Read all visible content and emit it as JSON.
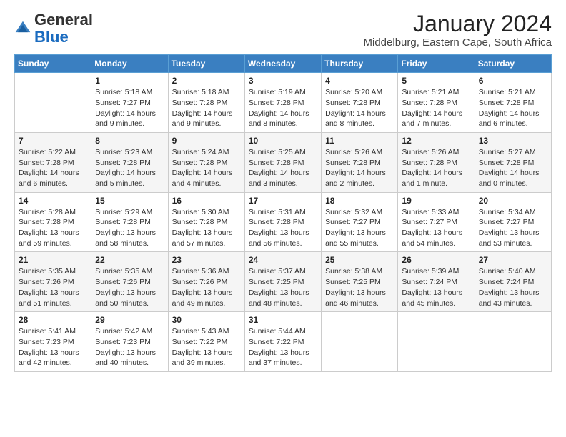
{
  "logo": {
    "general": "General",
    "blue": "Blue"
  },
  "header": {
    "month": "January 2024",
    "location": "Middelburg, Eastern Cape, South Africa"
  },
  "weekdays": [
    "Sunday",
    "Monday",
    "Tuesday",
    "Wednesday",
    "Thursday",
    "Friday",
    "Saturday"
  ],
  "weeks": [
    [
      {
        "day": "",
        "info": ""
      },
      {
        "day": "1",
        "info": "Sunrise: 5:18 AM\nSunset: 7:27 PM\nDaylight: 14 hours\nand 9 minutes."
      },
      {
        "day": "2",
        "info": "Sunrise: 5:18 AM\nSunset: 7:28 PM\nDaylight: 14 hours\nand 9 minutes."
      },
      {
        "day": "3",
        "info": "Sunrise: 5:19 AM\nSunset: 7:28 PM\nDaylight: 14 hours\nand 8 minutes."
      },
      {
        "day": "4",
        "info": "Sunrise: 5:20 AM\nSunset: 7:28 PM\nDaylight: 14 hours\nand 8 minutes."
      },
      {
        "day": "5",
        "info": "Sunrise: 5:21 AM\nSunset: 7:28 PM\nDaylight: 14 hours\nand 7 minutes."
      },
      {
        "day": "6",
        "info": "Sunrise: 5:21 AM\nSunset: 7:28 PM\nDaylight: 14 hours\nand 6 minutes."
      }
    ],
    [
      {
        "day": "7",
        "info": "Sunrise: 5:22 AM\nSunset: 7:28 PM\nDaylight: 14 hours\nand 6 minutes."
      },
      {
        "day": "8",
        "info": "Sunrise: 5:23 AM\nSunset: 7:28 PM\nDaylight: 14 hours\nand 5 minutes."
      },
      {
        "day": "9",
        "info": "Sunrise: 5:24 AM\nSunset: 7:28 PM\nDaylight: 14 hours\nand 4 minutes."
      },
      {
        "day": "10",
        "info": "Sunrise: 5:25 AM\nSunset: 7:28 PM\nDaylight: 14 hours\nand 3 minutes."
      },
      {
        "day": "11",
        "info": "Sunrise: 5:26 AM\nSunset: 7:28 PM\nDaylight: 14 hours\nand 2 minutes."
      },
      {
        "day": "12",
        "info": "Sunrise: 5:26 AM\nSunset: 7:28 PM\nDaylight: 14 hours\nand 1 minute."
      },
      {
        "day": "13",
        "info": "Sunrise: 5:27 AM\nSunset: 7:28 PM\nDaylight: 14 hours\nand 0 minutes."
      }
    ],
    [
      {
        "day": "14",
        "info": "Sunrise: 5:28 AM\nSunset: 7:28 PM\nDaylight: 13 hours\nand 59 minutes."
      },
      {
        "day": "15",
        "info": "Sunrise: 5:29 AM\nSunset: 7:28 PM\nDaylight: 13 hours\nand 58 minutes."
      },
      {
        "day": "16",
        "info": "Sunrise: 5:30 AM\nSunset: 7:28 PM\nDaylight: 13 hours\nand 57 minutes."
      },
      {
        "day": "17",
        "info": "Sunrise: 5:31 AM\nSunset: 7:28 PM\nDaylight: 13 hours\nand 56 minutes."
      },
      {
        "day": "18",
        "info": "Sunrise: 5:32 AM\nSunset: 7:27 PM\nDaylight: 13 hours\nand 55 minutes."
      },
      {
        "day": "19",
        "info": "Sunrise: 5:33 AM\nSunset: 7:27 PM\nDaylight: 13 hours\nand 54 minutes."
      },
      {
        "day": "20",
        "info": "Sunrise: 5:34 AM\nSunset: 7:27 PM\nDaylight: 13 hours\nand 53 minutes."
      }
    ],
    [
      {
        "day": "21",
        "info": "Sunrise: 5:35 AM\nSunset: 7:26 PM\nDaylight: 13 hours\nand 51 minutes."
      },
      {
        "day": "22",
        "info": "Sunrise: 5:35 AM\nSunset: 7:26 PM\nDaylight: 13 hours\nand 50 minutes."
      },
      {
        "day": "23",
        "info": "Sunrise: 5:36 AM\nSunset: 7:26 PM\nDaylight: 13 hours\nand 49 minutes."
      },
      {
        "day": "24",
        "info": "Sunrise: 5:37 AM\nSunset: 7:25 PM\nDaylight: 13 hours\nand 48 minutes."
      },
      {
        "day": "25",
        "info": "Sunrise: 5:38 AM\nSunset: 7:25 PM\nDaylight: 13 hours\nand 46 minutes."
      },
      {
        "day": "26",
        "info": "Sunrise: 5:39 AM\nSunset: 7:24 PM\nDaylight: 13 hours\nand 45 minutes."
      },
      {
        "day": "27",
        "info": "Sunrise: 5:40 AM\nSunset: 7:24 PM\nDaylight: 13 hours\nand 43 minutes."
      }
    ],
    [
      {
        "day": "28",
        "info": "Sunrise: 5:41 AM\nSunset: 7:23 PM\nDaylight: 13 hours\nand 42 minutes."
      },
      {
        "day": "29",
        "info": "Sunrise: 5:42 AM\nSunset: 7:23 PM\nDaylight: 13 hours\nand 40 minutes."
      },
      {
        "day": "30",
        "info": "Sunrise: 5:43 AM\nSunset: 7:22 PM\nDaylight: 13 hours\nand 39 minutes."
      },
      {
        "day": "31",
        "info": "Sunrise: 5:44 AM\nSunset: 7:22 PM\nDaylight: 13 hours\nand 37 minutes."
      },
      {
        "day": "",
        "info": ""
      },
      {
        "day": "",
        "info": ""
      },
      {
        "day": "",
        "info": ""
      }
    ]
  ]
}
